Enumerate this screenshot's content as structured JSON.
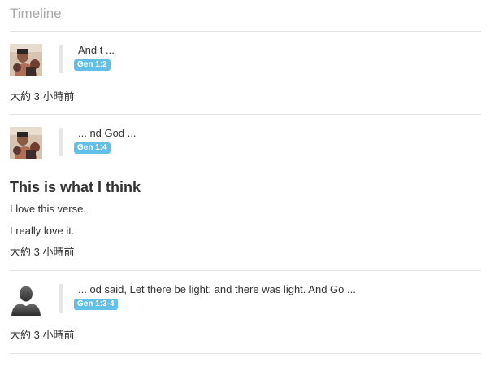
{
  "timeline": {
    "title": "Timeline",
    "entries": [
      {
        "avatar": "user-photo-avatar",
        "verse_text": "And t ...",
        "verse_ref": "Gen 1:2",
        "timestamp": "大約 3 小時前"
      },
      {
        "avatar": "user-photo-avatar",
        "verse_text": "... nd God ...",
        "verse_ref": "Gen 1:4",
        "note_title": "This is what I think",
        "note_lines": [
          "I love this verse.",
          "I really love it."
        ],
        "timestamp": "大約 3 小時前"
      },
      {
        "avatar": "default-user-silhouette-icon",
        "verse_text": "... od said, Let there be light: and there was light. And Go ...",
        "verse_ref": "Gen 1:3-4",
        "timestamp": "大約 3 小時前"
      }
    ]
  },
  "colors": {
    "badge": "#62c0e8",
    "title": "#a9a9a9",
    "divider": "#e2e2e2",
    "quote_bar": "#e6e6e6"
  }
}
